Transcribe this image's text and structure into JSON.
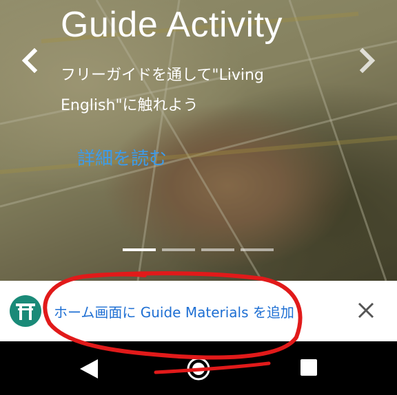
{
  "hero": {
    "title": "Guide Activity",
    "subtitle": "フリーガイドを通して\"Living English\"に触れよう",
    "read_more": "詳細を読む",
    "prev_icon": "chevron-left-icon",
    "next_icon": "chevron-right-icon",
    "slide_count": 4,
    "active_slide": 1
  },
  "banner": {
    "icon": "torii-gate-icon",
    "text": "ホーム画面に Guide Materials を追加",
    "close_icon": "close-icon",
    "text_color": "#1e6fd3",
    "icon_bg": "#1a8a78"
  },
  "navbar": {
    "back_icon": "back-triangle-icon",
    "home_icon": "home-circle-icon",
    "recent_icon": "recent-apps-square-icon"
  },
  "colors": {
    "link": "#3d9be9",
    "annotation": "#e11a1a"
  }
}
